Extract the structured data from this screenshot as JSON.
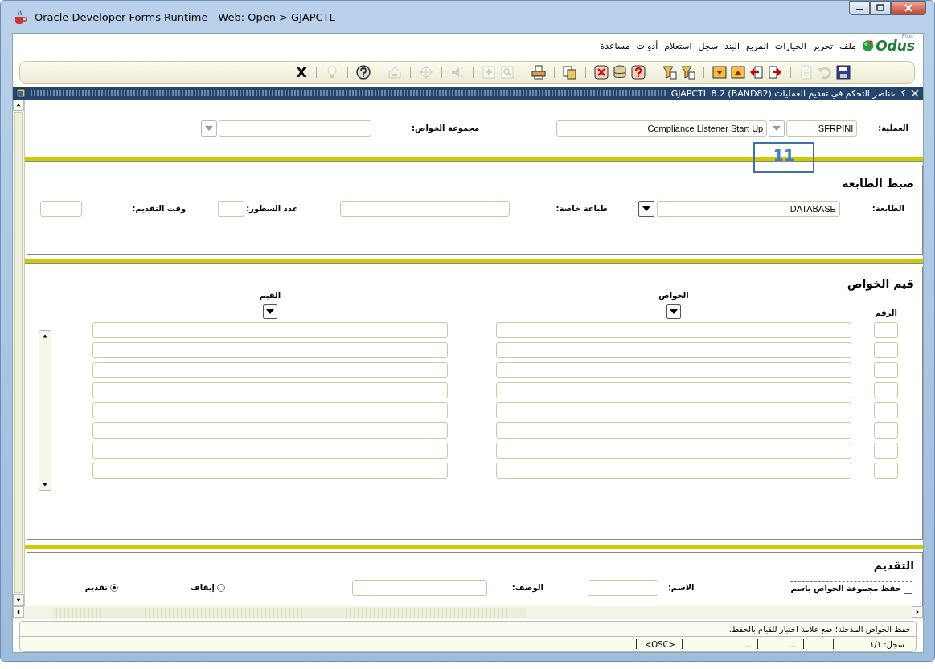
{
  "window": {
    "title": "Oracle Developer Forms Runtime - Web:  Open > GJAPCTL"
  },
  "logo": {
    "name": "Odus",
    "tag": "Plus"
  },
  "menu": [
    "ملف",
    "تحرير",
    "الخيارات",
    "المربع",
    "البند",
    "سجل",
    "استعلام",
    "أدوات",
    "مساعدة"
  ],
  "toolbar": [
    {
      "kind": "text",
      "label": "X"
    },
    {
      "kind": "separator"
    },
    {
      "kind": "bulb",
      "disabled": true
    },
    {
      "kind": "separator"
    },
    {
      "kind": "help",
      "disabled": false
    },
    {
      "kind": "separator"
    },
    {
      "kind": "house",
      "disabled": true
    },
    {
      "kind": "separator"
    },
    {
      "kind": "target",
      "disabled": true
    },
    {
      "kind": "separator"
    },
    {
      "kind": "speaker",
      "disabled": true
    },
    {
      "kind": "separator"
    },
    {
      "kind": "plus",
      "disabled": true
    },
    {
      "kind": "magnifier",
      "disabled": true
    },
    {
      "kind": "separator"
    },
    {
      "kind": "printer",
      "disabled": false
    },
    {
      "kind": "separator"
    },
    {
      "kind": "copy",
      "disabled": false
    },
    {
      "kind": "separator"
    },
    {
      "kind": "xmark",
      "disabled": false
    },
    {
      "kind": "database",
      "disabled": false
    },
    {
      "kind": "question",
      "disabled": false
    },
    {
      "kind": "separator"
    },
    {
      "kind": "filter",
      "disabled": false
    },
    {
      "kind": "filter",
      "disabled": false
    },
    {
      "kind": "separator"
    },
    {
      "kind": "down",
      "disabled": false
    },
    {
      "kind": "up",
      "disabled": false
    },
    {
      "kind": "left",
      "disabled": false
    },
    {
      "kind": "right",
      "disabled": false
    },
    {
      "kind": "separator"
    },
    {
      "kind": "page",
      "disabled": true
    },
    {
      "kind": "undo",
      "disabled": true
    },
    {
      "kind": "save",
      "disabled": false
    }
  ],
  "form": {
    "title": "كـ عناصر التحكم في تقديم العمليات  GJAPCTL  8.2  (BAND82)"
  },
  "key_block": {
    "process_label": "العملية:",
    "process_code": "SFRPINI",
    "process_dropdown_disabled": true,
    "process_name": "Compliance Listener Start Up",
    "parameter_set_label": "مجموعة الخواص:",
    "parameter_set_dropdown_disabled": true
  },
  "annotation": {
    "label": "11"
  },
  "printer_control": {
    "title": "ضبط الطابعة",
    "printer_label": "الطابعة:",
    "printer": "DATABASE",
    "special_print_label": "طباعة خاصة:",
    "lines_label": "عدد السطور:",
    "submit_time_label": "وقت التقديم:"
  },
  "parameter_values": {
    "title": "قيم الخواص",
    "columns": [
      {
        "label": "الرقم",
        "dropdown": false
      },
      {
        "label": "الخواص",
        "dropdown": true
      },
      {
        "label": "القيم",
        "dropdown": true
      }
    ]
  },
  "submission": {
    "title": "التقديم",
    "save_checkbox": {
      "label": "حفظ مجموعة الخواص باسم",
      "checked": false
    },
    "name_label": "الاسم:",
    "description_label": "الوصف:",
    "options": [
      {
        "label": "إيقاف",
        "selected": false
      },
      {
        "label": "تقديم",
        "selected": true
      }
    ]
  },
  "message": "حفظ الخواص المدخلة؛ ضع علامة اختيار للقيام بالحفظ.",
  "status_bar": {
    "record": "سجل: ١/١",
    "cells": [
      "...",
      "...",
      "<OSC>"
    ]
  }
}
